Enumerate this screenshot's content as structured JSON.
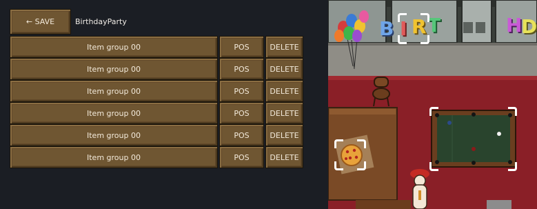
{
  "toolbar": {
    "save_label": "← SAVE",
    "party_name": "BirthdayParty"
  },
  "rows": [
    {
      "name": "Item group 00",
      "pos_label": "POS",
      "delete_label": "DELETE"
    },
    {
      "name": "Item group 00",
      "pos_label": "POS",
      "delete_label": "DELETE"
    },
    {
      "name": "Item group 00",
      "pos_label": "POS",
      "delete_label": "DELETE"
    },
    {
      "name": "Item group 00",
      "pos_label": "POS",
      "delete_label": "DELETE"
    },
    {
      "name": "Item group 00",
      "pos_label": "POS",
      "delete_label": "DELETE"
    },
    {
      "name": "Item group 00",
      "pos_label": "POS",
      "delete_label": "DELETE"
    }
  ],
  "scene": {
    "banner_letters": [
      "B",
      "I",
      "R",
      "T"
    ],
    "banner_letters_right": [
      "H",
      "D"
    ],
    "selected_objects": [
      "banner-letter-r",
      "pizza",
      "pool-table"
    ]
  },
  "colors": {
    "panel_bg": "#1b1e24",
    "button_wood": "#6f5632",
    "button_text": "#f3eadb",
    "carpet_red": "#8a1f27",
    "pool_felt": "#29442d",
    "selection": "#ffffff"
  }
}
